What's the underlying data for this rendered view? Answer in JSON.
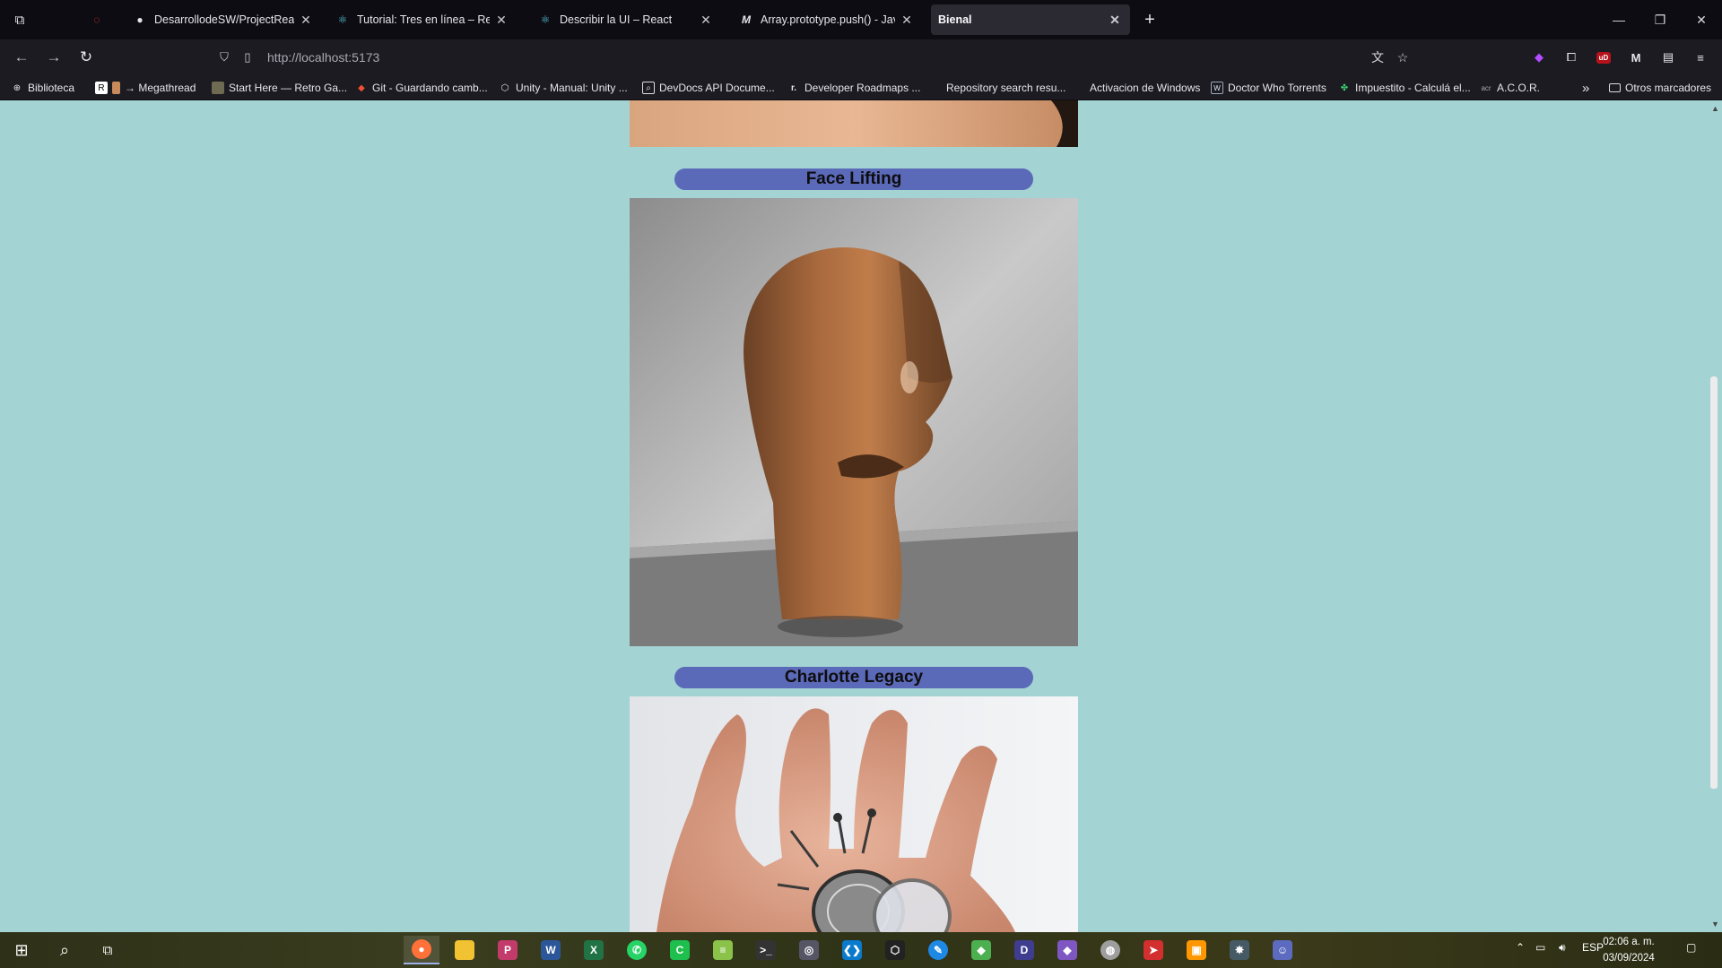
{
  "browser": {
    "tabs": [
      {
        "label": "",
        "icon": "opera-gx-icon",
        "active": false
      },
      {
        "label": "DesarrollodeSW/ProjectReact/B",
        "icon": "github-icon",
        "active": false
      },
      {
        "label": "Tutorial: Tres en línea – React",
        "icon": "react-icon",
        "active": false
      },
      {
        "label": "Describir la UI – React",
        "icon": "react-icon",
        "active": false
      },
      {
        "label": "Array.prototype.push() - JavaSc",
        "icon": "mdn-icon",
        "active": false
      },
      {
        "label": "Bienal",
        "icon": "",
        "active": true
      }
    ],
    "url": "http://localhost:5173",
    "bookmarks": [
      {
        "label": "Biblioteca",
        "icon": "globe-icon"
      },
      {
        "label": "→ Megathread",
        "icon": "bookmark-icon"
      },
      {
        "label": "Start Here — Retro Ga...",
        "icon": "retro-icon"
      },
      {
        "label": "Git - Guardando camb...",
        "icon": "git-icon"
      },
      {
        "label": "Unity - Manual: Unity ...",
        "icon": "unity-icon"
      },
      {
        "label": "DevDocs API Docume...",
        "icon": "devdocs-icon"
      },
      {
        "label": "Developer Roadmaps ...",
        "icon": "roadmap-icon"
      },
      {
        "label": "Repository search resu...",
        "icon": "github-icon"
      },
      {
        "label": "Activacion de Windows",
        "icon": "windows-icon"
      },
      {
        "label": "Doctor Who Torrents",
        "icon": "torrent-icon"
      },
      {
        "label": "Impuestito - Calculá el...",
        "icon": "leaf-icon"
      },
      {
        "label": "A.C.O.R.",
        "icon": "acor-icon"
      }
    ],
    "other_bookmarks": "Otros marcadores"
  },
  "page": {
    "items": [
      {
        "title": "Face Lifting",
        "image": "wooden-head-sculpture"
      },
      {
        "title": "Charlotte Legacy",
        "image": "spider-brooch-on-hand"
      }
    ]
  },
  "taskbar": {
    "language": "ESP",
    "time": "02:06 a. m.",
    "date": "03/09/2024"
  },
  "colors": {
    "page_bg": "#a3d3d3",
    "title_pill": "#5b69b9",
    "tab_bar": "#0d0c12",
    "toolbar": "#1c1b22"
  }
}
